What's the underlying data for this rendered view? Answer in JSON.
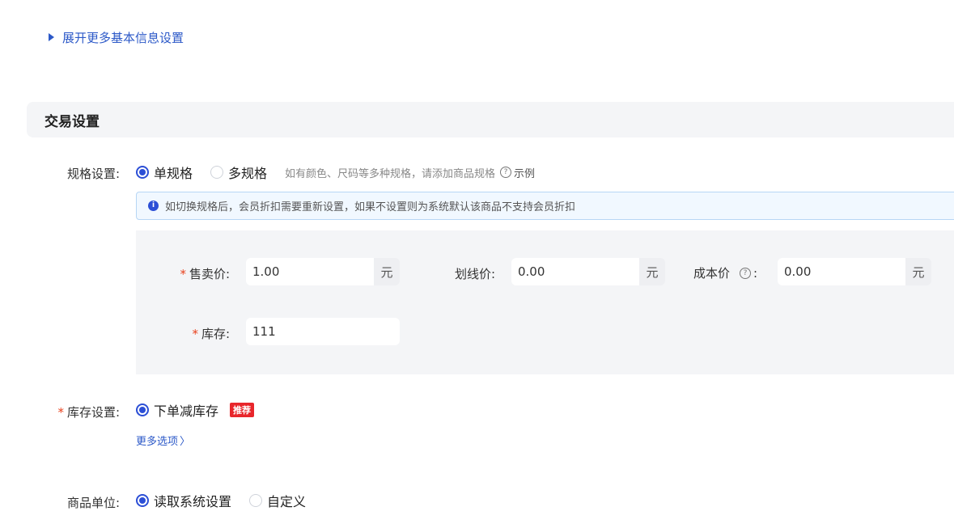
{
  "expand_link": "展开更多基本信息设置",
  "section": {
    "title": "交易设置"
  },
  "spec": {
    "label": "规格设置:",
    "options": [
      "单规格",
      "多规格"
    ],
    "selected": "单规格",
    "hint": "如有颜色、尺码等多种规格，请添加商品规格",
    "example": "示例",
    "help_symbol": "?"
  },
  "notice": {
    "icon": "info-icon",
    "icon_symbol": "i",
    "text": "如切换规格后，会员折扣需要重新设置，如果不设置则为系统默认该商品不支持会员折扣"
  },
  "price": {
    "sale_label": "售卖价:",
    "sale_value": "1.00",
    "strike_label": "划线价:",
    "strike_value": "0.00",
    "cost_label": "成本价",
    "cost_colon": ":",
    "cost_value": "0.00",
    "unit": "元",
    "stock_label": "库存:",
    "stock_value": "111",
    "required_mark": "*"
  },
  "inventory": {
    "label": "库存设置:",
    "option": "下单减库存",
    "badge": "推荐",
    "more_options": "更多选项",
    "more_chevron": "〉"
  },
  "unit_setting": {
    "label": "商品单位:",
    "options": [
      "读取系统设置",
      "自定义"
    ],
    "selected": "读取系统设置"
  }
}
